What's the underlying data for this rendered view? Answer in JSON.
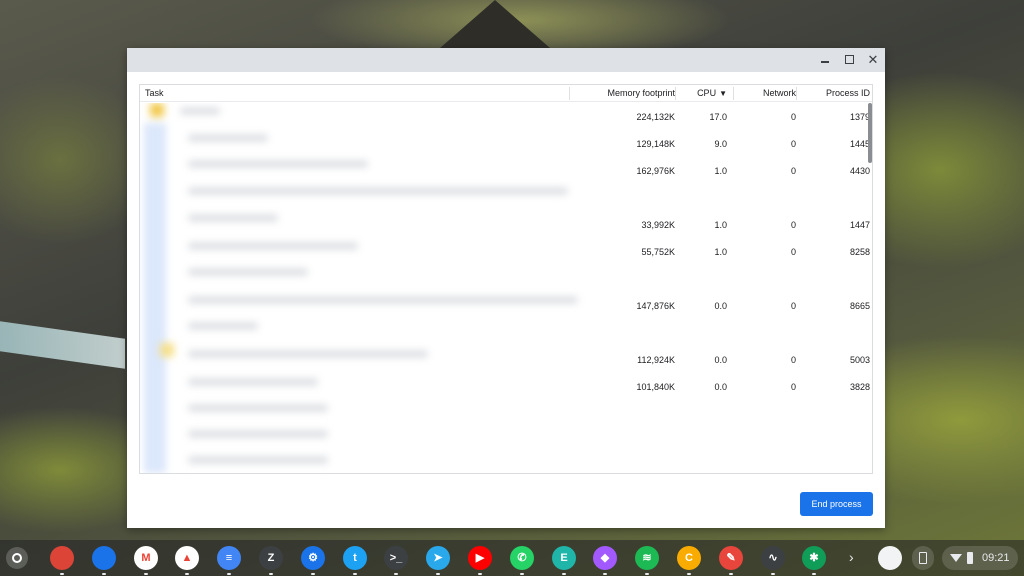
{
  "window": {
    "controls": {
      "minimize": "minimize",
      "maximize": "maximize",
      "close": "✕"
    }
  },
  "table": {
    "headers": {
      "task": "Task",
      "memory": "Memory footprint",
      "cpu": "CPU",
      "cpu_sort_icon": "▼",
      "network": "Network",
      "pid": "Process ID"
    },
    "rows": [
      {
        "memory": "224,132K",
        "cpu": "17.0",
        "network": "0",
        "pid": "1379"
      },
      {
        "memory": "129,148K",
        "cpu": "9.0",
        "network": "0",
        "pid": "1445"
      },
      {
        "memory": "162,976K",
        "cpu": "1.0",
        "network": "0",
        "pid": "4430"
      },
      {
        "memory": "33,992K",
        "cpu": "1.0",
        "network": "0",
        "pid": "1447"
      },
      {
        "memory": "55,752K",
        "cpu": "1.0",
        "network": "0",
        "pid": "8258"
      },
      {
        "memory": "147,876K",
        "cpu": "0.0",
        "network": "0",
        "pid": "8665"
      },
      {
        "memory": "112,924K",
        "cpu": "0.0",
        "network": "0",
        "pid": "5003"
      },
      {
        "memory": "101,840K",
        "cpu": "0.0",
        "network": "0",
        "pid": "3828"
      }
    ]
  },
  "actions": {
    "end_process": "End process"
  },
  "shelf": {
    "apps": [
      {
        "name": "chrome",
        "glyph": "",
        "color": "#db4437"
      },
      {
        "name": "files",
        "glyph": "",
        "color": "#1a73e8"
      },
      {
        "name": "gmail",
        "glyph": "M",
        "color": "#ffffff"
      },
      {
        "name": "drive",
        "glyph": "▲",
        "color": "#ffffff"
      },
      {
        "name": "docs",
        "glyph": "≡",
        "color": "#4285f4"
      },
      {
        "name": "zoom-like",
        "glyph": "Z",
        "color": "#3c4043"
      },
      {
        "name": "settings",
        "glyph": "⚙",
        "color": "#1a73e8"
      },
      {
        "name": "twitter",
        "glyph": "t",
        "color": "#1da1f2"
      },
      {
        "name": "terminal",
        "glyph": ">_",
        "color": "#3c4043"
      },
      {
        "name": "telegram",
        "glyph": "➤",
        "color": "#29a9eb"
      },
      {
        "name": "youtube",
        "glyph": "▶",
        "color": "#ff0000"
      },
      {
        "name": "whatsapp",
        "glyph": "✆",
        "color": "#25d366"
      },
      {
        "name": "e-app",
        "glyph": "E",
        "color": "#1fb5a8"
      },
      {
        "name": "figma",
        "glyph": "◆",
        "color": "#a259ff"
      },
      {
        "name": "spotify",
        "glyph": "≋",
        "color": "#1db954"
      },
      {
        "name": "c-app",
        "glyph": "C",
        "color": "#f9ab00"
      },
      {
        "name": "paint",
        "glyph": "✎",
        "color": "#e8453c"
      },
      {
        "name": "activity",
        "glyph": "∿",
        "color": "#3c4043"
      },
      {
        "name": "bug-app",
        "glyph": "✱",
        "color": "#0f9d58"
      }
    ],
    "time": "09:21"
  }
}
